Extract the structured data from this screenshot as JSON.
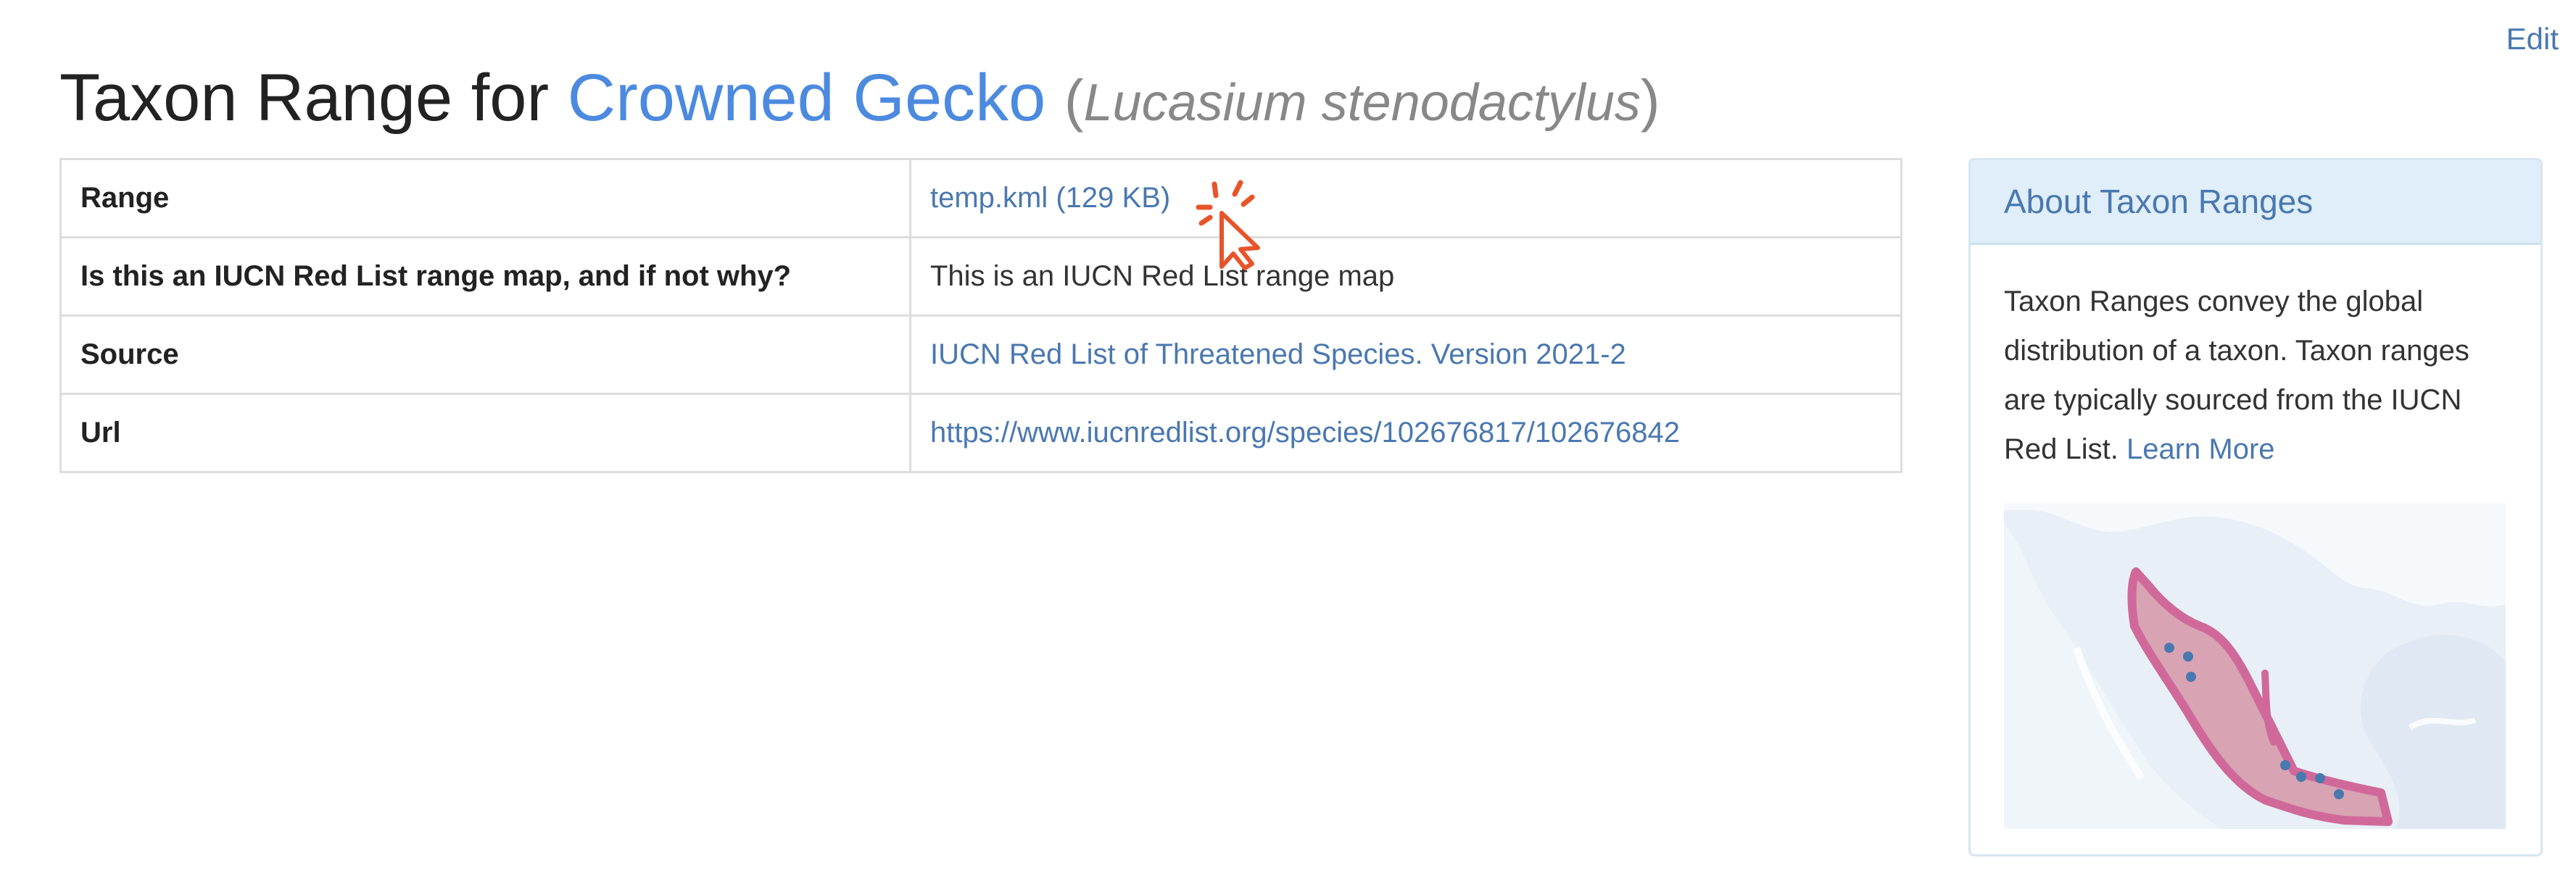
{
  "header": {
    "edit_label": "Edit",
    "title_prefix": "Taxon Range for ",
    "common_name": "Crowned Gecko",
    "paren_open": "(",
    "scientific_name": "Lucasium stenodactylus",
    "paren_close": ")"
  },
  "table": {
    "rows": [
      {
        "label": "Range",
        "value": "temp.kml (129 KB)"
      },
      {
        "label": "Is this an IUCN Red List range map, and if not why?",
        "value": "This is an IUCN Red List range map"
      },
      {
        "label": "Source",
        "value": "IUCN Red List of Threatened Species. Version 2021-2"
      },
      {
        "label": "Url",
        "value": "https://www.iucnredlist.org/species/102676817/102676842"
      }
    ]
  },
  "sidebar": {
    "heading": "About Taxon Ranges",
    "body_text": "Taxon Ranges convey the global distribution of a taxon. Taxon ranges are typically sourced from the IUCN Red List.",
    "learn_more": "Learn More"
  },
  "colors": {
    "link": "#4a78b0",
    "common_name": "#4c8ae0",
    "panel_header_bg": "#dfeef8",
    "cursor": "#e8542a",
    "range_fill": "#d8a3b3",
    "range_stroke": "#d0699a",
    "point": "#4a78b0"
  },
  "icons": {
    "cursor": "click-cursor-icon"
  }
}
